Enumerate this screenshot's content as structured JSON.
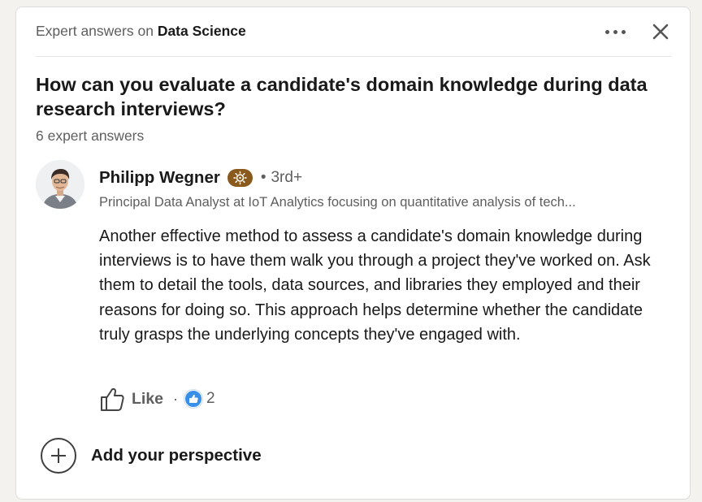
{
  "header": {
    "prefix": "Expert answers on",
    "topic": "Data Science"
  },
  "question": {
    "title": "How can you evaluate a candidate's domain knowledge during data research interviews?",
    "answers_count": "6 expert answers"
  },
  "answer": {
    "author_name": "Philipp Wegner",
    "badge_icon": "lightbulb-badge-icon",
    "separator": "•",
    "connection_degree": "3rd+",
    "headline": "Principal Data Analyst at IoT Analytics focusing on quantitative analysis of tech...",
    "body": "Another effective method to assess a candidate's domain knowledge during interviews is to have them walk you through a project they've worked on. Ask them to detail the tools, data sources, and libraries they employed and their reasons for doing so. This approach helps determine whether the candidate truly grasps the underlying concepts they've engaged with.",
    "like_label": "Like",
    "reaction_separator": "·",
    "reaction_count": "2"
  },
  "footer": {
    "add_perspective_label": "Add your perspective"
  },
  "colors": {
    "badge": "#8a5a1c",
    "reaction": "#378fe9",
    "muted_text": "#5e5e5e",
    "primary_text": "#191919"
  }
}
